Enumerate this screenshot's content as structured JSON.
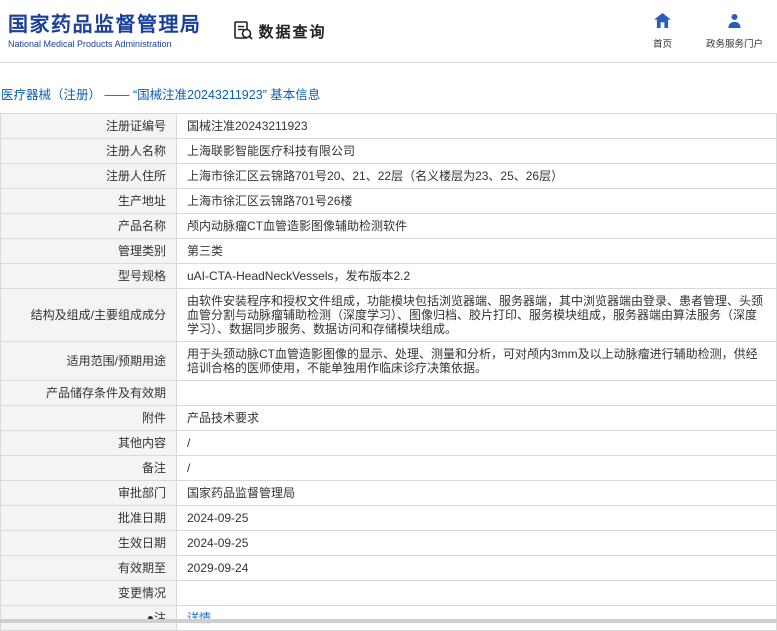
{
  "header": {
    "org_name": "国家药品监督管理局",
    "org_name_en": "National Medical Products Administration",
    "section_label": "数据查询",
    "nav": [
      {
        "label": "首页",
        "icon": "home-icon"
      },
      {
        "label": "政务服务门户",
        "icon": "user-icon"
      }
    ]
  },
  "breadcrumb": "医疗器械（注册） —— “国械注准20243211923” 基本信息",
  "table": {
    "rows": [
      {
        "label": "注册证编号",
        "value": "国械注准20243211923"
      },
      {
        "label": "注册人名称",
        "value": "上海联影智能医疗科技有限公司"
      },
      {
        "label": "注册人住所",
        "value": "上海市徐汇区云锦路701号20、21、22层（名义楼层为23、25、26层）"
      },
      {
        "label": "生产地址",
        "value": "上海市徐汇区云锦路701号26楼"
      },
      {
        "label": "产品名称",
        "value": "颅内动脉瘤CT血管造影图像辅助检测软件"
      },
      {
        "label": "管理类别",
        "value": "第三类"
      },
      {
        "label": "型号规格",
        "value": "uAI-CTA-HeadNeckVessels，发布版本2.2"
      },
      {
        "label": "结构及组成/主要组成成分",
        "value": "由软件安装程序和授权文件组成，功能模块包括浏览器端、服务器端，其中浏览器端由登录、患者管理、头颈血管分割与动脉瘤辅助检测（深度学习）、图像归档、胶片打印、服务模块组成，服务器端由算法服务（深度学习）、数据同步服务、数据访问和存储模块组成。"
      },
      {
        "label": "适用范围/预期用途",
        "value": "用于头颈动脉CT血管造影图像的显示、处理、测量和分析，可对颅内3mm及以上动脉瘤进行辅助检测，供经培训合格的医师使用，不能单独用作临床诊疗决策依据。"
      },
      {
        "label": "产品储存条件及有效期",
        "value": ""
      },
      {
        "label": "附件",
        "value": "产品技术要求"
      },
      {
        "label": "其他内容",
        "value": "/"
      },
      {
        "label": "备注",
        "value": "/"
      },
      {
        "label": "审批部门",
        "value": "国家药品监督管理局"
      },
      {
        "label": "批准日期",
        "value": "2024-09-25"
      },
      {
        "label": "生效日期",
        "value": "2024-09-25"
      },
      {
        "label": "有效期至",
        "value": "2029-09-24"
      },
      {
        "label": "变更情况",
        "value": ""
      },
      {
        "label": "●注",
        "value": "详情",
        "link": true
      }
    ]
  },
  "colors": {
    "brand_blue": "#1a3f9c",
    "icon_blue": "#2a5cba",
    "breadcrumb_blue": "#0b5fb4",
    "link_blue": "#1a6ecc",
    "label_bg": "#f4f4f4",
    "border": "#d9d9d9"
  }
}
